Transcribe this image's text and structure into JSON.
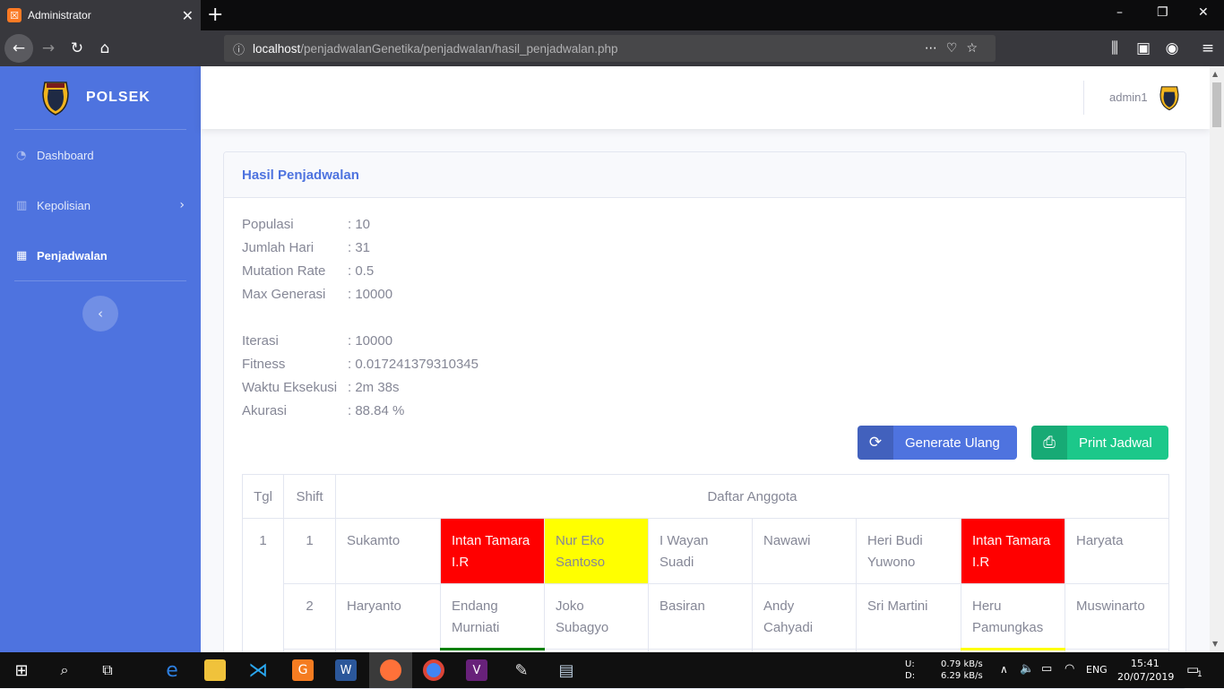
{
  "browser": {
    "tab_title": "Administrator",
    "url_host": "localhost",
    "url_path": "/penjadwalanGenetika/penjadwalan/hasil_penjadwalan.php"
  },
  "sidebar": {
    "brand": "POLSEK",
    "items": [
      {
        "label": "Dashboard",
        "icon": "tachometer-icon"
      },
      {
        "label": "Kepolisian",
        "icon": "building-icon"
      },
      {
        "label": "Penjadwalan",
        "icon": "table-icon"
      }
    ]
  },
  "topbar": {
    "username": "admin1"
  },
  "card": {
    "title": "Hasil Penjadwalan",
    "params": [
      {
        "label": "Populasi",
        "value": ": 10"
      },
      {
        "label": "Jumlah Hari",
        "value": ": 31"
      },
      {
        "label": "Mutation Rate",
        "value": ": 0.5"
      },
      {
        "label": "Max Generasi",
        "value": ": 10000"
      }
    ],
    "results": [
      {
        "label": "Iterasi",
        "value": ": 10000"
      },
      {
        "label": "Fitness",
        "value": ": 0.017241379310345"
      },
      {
        "label": "Waktu Eksekusi",
        "value": ": 2m 38s"
      },
      {
        "label": "Akurasi",
        "value": ": 88.84 %"
      }
    ],
    "buttons": {
      "generate": "Generate Ulang",
      "print": "Print Jadwal"
    }
  },
  "table": {
    "headers": [
      "Tgl",
      "Shift",
      "Daftar Anggota"
    ],
    "rows": [
      {
        "tgl": "1",
        "shift": "1",
        "members": [
          "Sukamto",
          "Intan Tamara I.R",
          "Nur Eko Santoso",
          "I Wayan Suadi",
          "Nawawi",
          "Heri Budi Yuwono",
          "Intan Tamara I.R",
          "Haryata"
        ]
      },
      {
        "tgl": "",
        "shift": "2",
        "members": [
          "Haryanto",
          "Endang Murniati",
          "Joko Subagyo",
          "Basiran",
          "Andy Cahyadi",
          "Sri Martini",
          "Heru Pamungkas",
          "Muswinarto"
        ]
      }
    ],
    "highlight_colors": {
      "conflict": "#ff0000",
      "warning": "#ffff00"
    }
  },
  "taskbar": {
    "upload": "U:",
    "download": "D:",
    "upload_speed": "0.79 kB/s",
    "download_speed": "6.29 kB/s",
    "language": "ENG",
    "time": "15:41",
    "date": "20/07/2019",
    "notifications": "1"
  }
}
